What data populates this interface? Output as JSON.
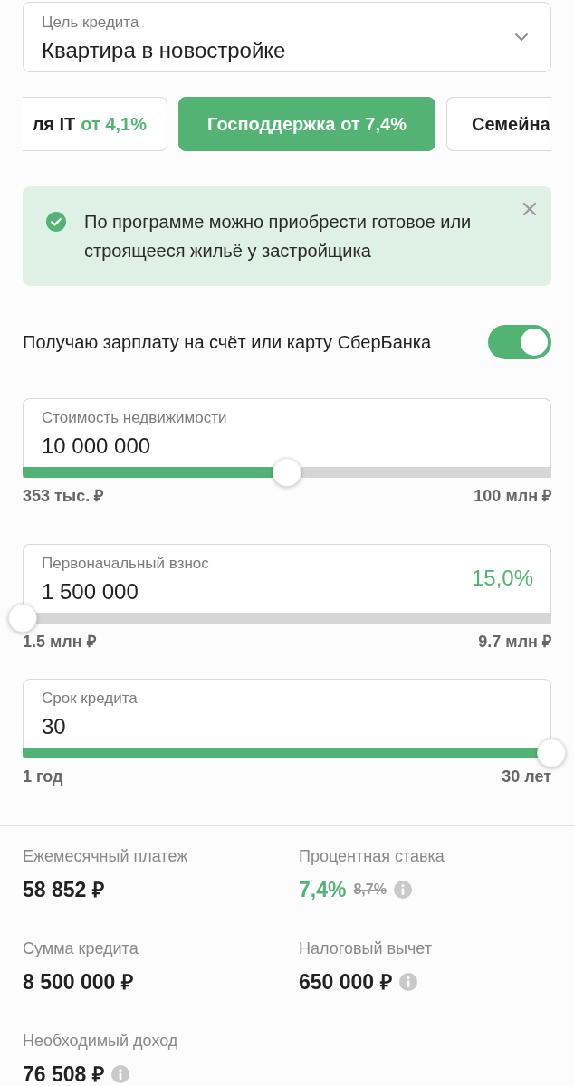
{
  "purpose_select": {
    "label": "Цель кредита",
    "value": "Квартира в новостройке"
  },
  "programs": [
    {
      "label": "ля IT",
      "rate": "от 4,1%",
      "selected": false
    },
    {
      "label": "Господдержка",
      "rate": "от 7,4%",
      "selected": true
    },
    {
      "label": "Семейна",
      "selected": false
    }
  ],
  "notice": {
    "text": "По программе можно приобрести готовое или строящееся жильё у застройщика"
  },
  "salary_toggle": {
    "label": "Получаю зарплату на счёт или карту СберБанка",
    "on": true
  },
  "sliders": [
    {
      "label": "Стоимость недвижимости",
      "value": "10 000 000",
      "level": 0.5,
      "min": "353 тыс. ₽",
      "max": "100 млн ₽"
    },
    {
      "label": "Первоначальный взнос",
      "value": "1 500 000",
      "percent": "15,0%",
      "level": 0,
      "min": "1.5 млн ₽",
      "max": "9.7 млн ₽"
    },
    {
      "label": "Срок кредита",
      "value": "30",
      "level": 1,
      "min": "1 год",
      "max": "30 лет"
    }
  ],
  "results": [
    {
      "kind": "amount",
      "label": "Ежемесячный платеж",
      "value": "58 852 ₽"
    },
    {
      "kind": "rate",
      "label": "Процентная ставка",
      "value": "7,4%",
      "old_value": "8,7%",
      "info": true
    },
    {
      "kind": "amount",
      "label": "Сумма кредита",
      "value": "8 500 000 ₽"
    },
    {
      "kind": "amount",
      "label": "Налоговый вычет",
      "value": "650 000 ₽",
      "info": true
    },
    {
      "kind": "amount",
      "label": "Необходимый доход",
      "value": "76 508 ₽",
      "info": true
    }
  ]
}
